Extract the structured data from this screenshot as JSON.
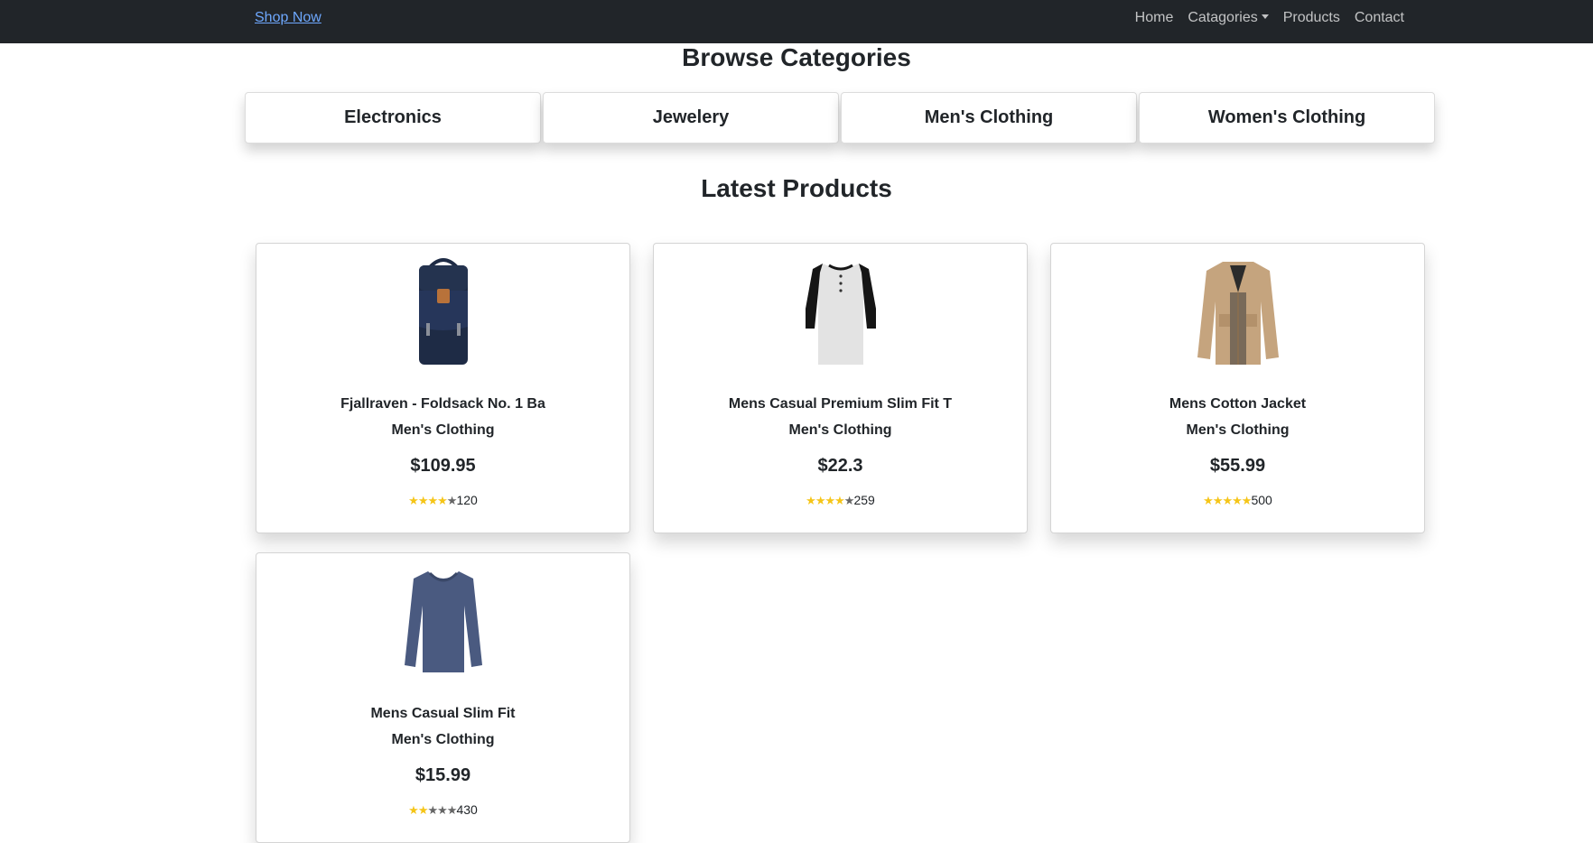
{
  "navbar": {
    "brand": "Shop Now",
    "links": {
      "home": "Home",
      "categories": "Catagories",
      "products": "Products",
      "contact": "Contact"
    }
  },
  "browse": {
    "title": "Browse Categories",
    "categories": [
      "Electronics",
      "Jewelery",
      "Men's Clothing",
      "Women's Clothing"
    ]
  },
  "latest": {
    "title": "Latest Products",
    "products": [
      {
        "title": "Fjallraven - Foldsack No. 1 Ba",
        "category": "Men's Clothing",
        "price": "$109.95",
        "rating": 3.9,
        "count": "120",
        "image_icon": "backpack-icon"
      },
      {
        "title": "Mens Casual Premium Slim Fit T",
        "category": "Men's Clothing",
        "price": "$22.3",
        "rating": 4.1,
        "count": "259",
        "image_icon": "tshirt-icon"
      },
      {
        "title": "Mens Cotton Jacket",
        "category": "Men's Clothing",
        "price": "$55.99",
        "rating": 4.7,
        "count": "500",
        "image_icon": "jacket-icon"
      },
      {
        "title": "Mens Casual Slim Fit",
        "category": "Men's Clothing",
        "price": "$15.99",
        "rating": 2.1,
        "count": "430",
        "image_icon": "longsleeve-icon"
      }
    ]
  },
  "colors": {
    "navbar_bg": "#212529",
    "brand_link": "#6ea8fe",
    "star_filled": "#f5c518",
    "star_empty": "#666666"
  }
}
